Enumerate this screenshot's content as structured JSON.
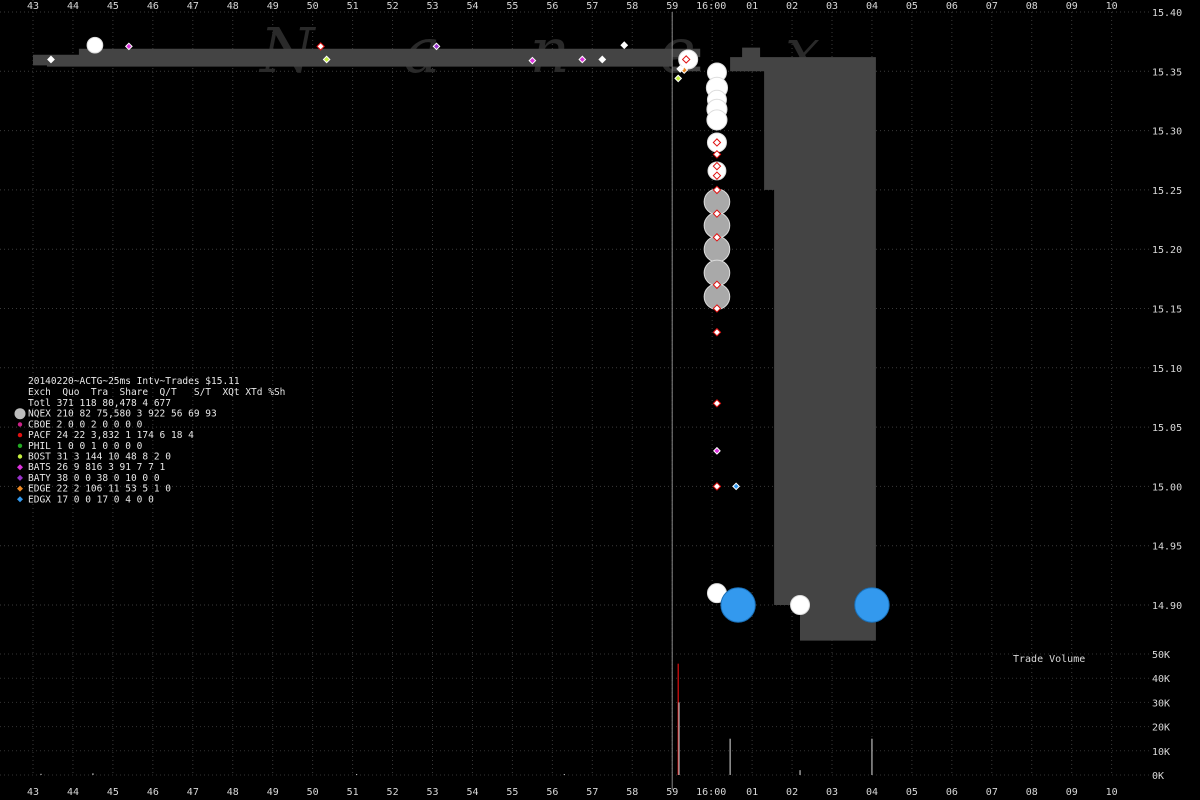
{
  "watermark": "Nanex",
  "chart_data": {
    "type": "scatter",
    "title": "20140220~ACTG~25ms Intv~Trades $15.11",
    "x_ticks_main": [
      "43",
      "44",
      "45",
      "46",
      "47",
      "48",
      "49",
      "50",
      "51",
      "52",
      "53",
      "54",
      "55",
      "56",
      "57",
      "58",
      "59",
      "16:00",
      "01",
      "02",
      "03",
      "04",
      "05",
      "06",
      "07",
      "08",
      "09",
      "10"
    ],
    "y_ticks": [
      "15.40",
      "15.35",
      "15.30",
      "15.25",
      "15.20",
      "15.15",
      "15.10",
      "15.05",
      "15.00",
      "14.95",
      "14.90"
    ],
    "ylim": [
      14.86,
      15.41
    ],
    "volume_label": "Trade Volume",
    "volume_ticks": [
      "50K",
      "40K",
      "30K",
      "20K",
      "10K",
      "0K"
    ],
    "volume_ylim": [
      0,
      50000
    ],
    "grid": true,
    "colors": {
      "NQEX": "#bdbdbd",
      "CBOE": "#cc2288",
      "PACF": "#e01010",
      "PHIL": "#22aa22",
      "BOST": "#c6f040",
      "BATS": "#dd33dd",
      "BATY": "#9933cc",
      "EDGE": "#ee8822",
      "EDGX": "#3399ee",
      "NBBO": "#444444"
    },
    "table": {
      "header": "Exch  Quo  Tra  Share  Q/T   S/T  XQt XTd %Sh",
      "rows": [
        {
          "exch": "Totl",
          "line": "Totl  371  118 80,478    4   677"
        },
        {
          "exch": "NQEX",
          "line": "NQEX  210   82 75,580    3   922  56  69  93"
        },
        {
          "exch": "CBOE",
          "line": "CBOE    2    0      0    2     0   0   0   0"
        },
        {
          "exch": "PACF",
          "line": "PACF   24   22  3,832    1   174   6  18   4"
        },
        {
          "exch": "PHIL",
          "line": "PHIL    1    0      0    1     0   0   0   0"
        },
        {
          "exch": "BOST",
          "line": "BOST   31    3    144   10    48   8   2   0"
        },
        {
          "exch": "BATS",
          "line": "BATS   26    9    816    3    91   7   7   1"
        },
        {
          "exch": "BATY",
          "line": "BATY   38    0      0   38     0  10   0   0"
        },
        {
          "exch": "EDGE",
          "line": "EDGE   22    2    106   11    53   5   1   0"
        },
        {
          "exch": "EDGX",
          "line": "EDGX   17    0      0   17     0   4   0   0"
        }
      ]
    },
    "nbbo_polygon": [
      [
        0,
        15.364
      ],
      [
        1.15,
        15.364
      ],
      [
        1.15,
        15.369
      ],
      [
        16.0,
        15.369
      ],
      [
        16.0,
        15.369
      ],
      [
        16.7,
        15.369
      ],
      [
        16.7,
        15.362
      ],
      [
        16.0,
        15.362
      ],
      [
        16.0,
        15.35
      ],
      [
        17.0,
        15.35
      ],
      [
        17.0,
        15.35
      ],
      [
        17.45,
        15.35
      ],
      [
        17.45,
        15.362
      ],
      [
        17.75,
        15.362
      ],
      [
        17.75,
        15.37
      ],
      [
        18.2,
        15.37
      ],
      [
        18.2,
        15.362
      ],
      [
        21.1,
        15.362
      ],
      [
        21.1,
        14.87
      ],
      [
        19.2,
        14.87
      ],
      [
        19.2,
        14.9
      ],
      [
        18.55,
        14.9
      ],
      [
        18.55,
        15.25
      ],
      [
        18.3,
        15.25
      ],
      [
        18.3,
        15.35
      ],
      [
        16.7,
        15.35
      ],
      [
        16.7,
        15.354
      ],
      [
        0.35,
        15.354
      ],
      [
        0.35,
        15.355
      ],
      [
        0,
        15.355
      ]
    ],
    "series": [
      {
        "name": "NQEX",
        "type": "trades",
        "points": [
          [
            1.55,
            15.372,
            0.7
          ],
          [
            17.12,
            15.349,
            1.0
          ],
          [
            17.12,
            15.336,
            1.2
          ],
          [
            17.12,
            15.326,
            1.0
          ],
          [
            17.12,
            15.318,
            1.1
          ],
          [
            17.12,
            15.309,
            1.1
          ],
          [
            17.12,
            15.29,
            1.0
          ],
          [
            17.12,
            15.266,
            0.9
          ],
          [
            17.12,
            15.24,
            1.6
          ],
          [
            17.12,
            15.22,
            1.6
          ],
          [
            17.12,
            15.2,
            1.6
          ],
          [
            17.12,
            15.18,
            1.6
          ],
          [
            17.12,
            15.16,
            1.6
          ],
          [
            17.12,
            14.91,
            1.0
          ],
          [
            19.2,
            14.9,
            1.0
          ],
          [
            16.4,
            15.36,
            1.0
          ]
        ]
      },
      {
        "name": "EDGX",
        "type": "trades",
        "points": [
          [
            17.65,
            14.9,
            2.4
          ],
          [
            21.0,
            14.9,
            2.4
          ]
        ]
      },
      {
        "name": "PACF",
        "type": "quotes",
        "points": [
          [
            17.12,
            15.28,
            0
          ],
          [
            17.12,
            15.27,
            0
          ],
          [
            17.12,
            15.262,
            0
          ],
          [
            17.12,
            15.25,
            0
          ],
          [
            17.12,
            15.23,
            0
          ],
          [
            17.12,
            15.21,
            0
          ],
          [
            17.12,
            15.17,
            0
          ],
          [
            17.12,
            15.15,
            0
          ],
          [
            17.12,
            15.13,
            0
          ],
          [
            17.12,
            15.07,
            0
          ],
          [
            17.12,
            15.0,
            0
          ],
          [
            17.12,
            15.29,
            0
          ],
          [
            16.35,
            15.36,
            0
          ],
          [
            7.2,
            15.371,
            0
          ]
        ]
      },
      {
        "name": "BATS",
        "type": "quotes",
        "points": [
          [
            2.4,
            15.371,
            0
          ],
          [
            13.75,
            15.36,
            0
          ],
          [
            17.12,
            15.03,
            0
          ],
          [
            12.5,
            15.359,
            0
          ]
        ]
      },
      {
        "name": "BATY",
        "type": "quotes",
        "points": [
          [
            10.1,
            15.371,
            0
          ]
        ]
      },
      {
        "name": "BOST",
        "type": "quotes",
        "points": [
          [
            7.35,
            15.36,
            0
          ],
          [
            16.15,
            15.344,
            0
          ],
          [
            16.3,
            15.352,
            0
          ]
        ]
      },
      {
        "name": "EDGE",
        "type": "quotes",
        "points": [
          [
            16.3,
            15.351,
            0
          ]
        ]
      },
      {
        "name": "EDGX",
        "type": "quotes",
        "points": [
          [
            17.6,
            15.0,
            0
          ]
        ]
      },
      {
        "name": "WHITE",
        "type": "quotes",
        "points": [
          [
            0.45,
            15.36,
            0
          ],
          [
            14.25,
            15.36,
            0
          ],
          [
            14.8,
            15.372,
            0
          ],
          [
            16.2,
            15.352,
            0
          ]
        ]
      }
    ],
    "volume": [
      [
        16.15,
        46000,
        "#e01010"
      ],
      [
        16.17,
        30000,
        "#bbbbbb"
      ],
      [
        17.45,
        15000,
        "#bbbbbb"
      ],
      [
        19.2,
        2000,
        "#bbbbbb"
      ],
      [
        21.0,
        15000,
        "#bbbbbb"
      ],
      [
        0.2,
        500,
        "#bbbbbb"
      ],
      [
        1.5,
        700,
        "#bbbbbb"
      ],
      [
        8.1,
        400,
        "#bbbbbb"
      ],
      [
        13.3,
        400,
        "#bbbbbb"
      ]
    ],
    "cursor_x": 16.0
  }
}
